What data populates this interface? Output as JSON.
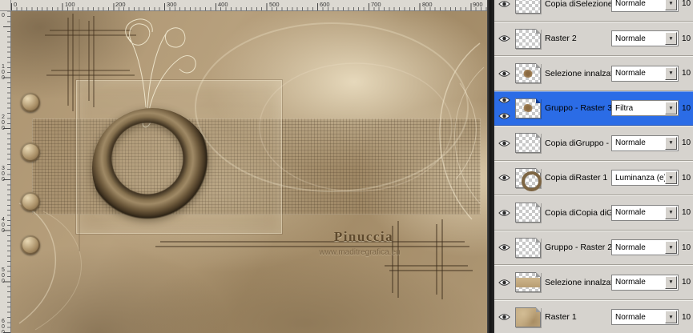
{
  "rulers": {
    "h": [
      "0",
      "100",
      "200",
      "300",
      "400",
      "500",
      "600",
      "700",
      "800",
      "900"
    ],
    "v": [
      "0",
      "100",
      "200",
      "300",
      "400",
      "500",
      "600"
    ]
  },
  "canvas": {
    "signature": "Pinuccia",
    "website": "www.maditregrafica.eu"
  },
  "layers": {
    "rows": [
      {
        "name": "Copia diSelezione in",
        "blend": "Normale",
        "opacity": "10"
      },
      {
        "name": "Raster 2",
        "blend": "Normale",
        "opacity": "10"
      },
      {
        "name": "Selezione innalzata",
        "blend": "Normale",
        "opacity": "10"
      },
      {
        "name": "Gruppo - Raster 3",
        "blend": "Filtra",
        "opacity": "10",
        "selected": true
      },
      {
        "name": "Copia diGruppo - Ra",
        "blend": "Normale",
        "opacity": "10"
      },
      {
        "name": "Copia diRaster 1",
        "blend": "Luminanza (e)",
        "opacity": "10"
      },
      {
        "name": "Copia diCopia diGru",
        "blend": "Normale",
        "opacity": "10"
      },
      {
        "name": "Gruppo - Raster 2",
        "blend": "Normale",
        "opacity": "10"
      },
      {
        "name": "Selezione innalzata",
        "blend": "Normale",
        "opacity": "10"
      },
      {
        "name": "Raster 1",
        "blend": "Normale",
        "opacity": "10"
      }
    ]
  },
  "colors": {
    "selected_row": "#2b6ce6",
    "panel_bg": "#d6d3ce",
    "canvas_sepia": "#ac9470"
  }
}
